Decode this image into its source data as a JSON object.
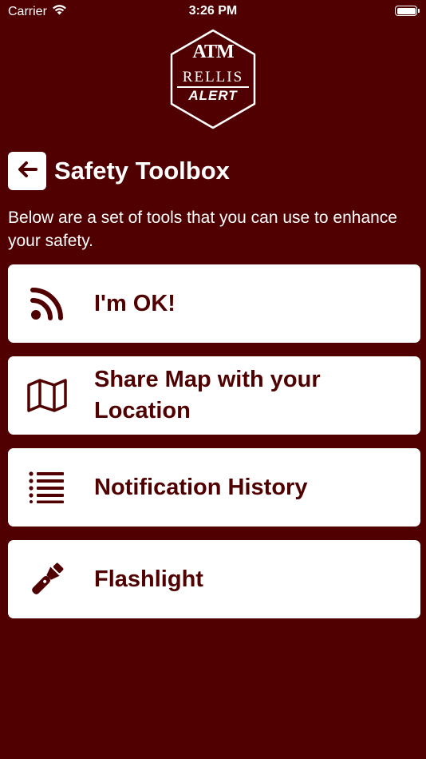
{
  "status_bar": {
    "carrier": "Carrier",
    "time": "3:26 PM",
    "icons": [
      "wifi-icon",
      "battery-icon"
    ]
  },
  "logo": {
    "monogram": "ATM",
    "name": "RELLIS",
    "tagline": "ALERT"
  },
  "header": {
    "back_icon": "arrow-left-icon",
    "title": "Safety Toolbox"
  },
  "intro_text": "Below are a set of tools that you can use to enhance your safety.",
  "tools": [
    {
      "label": "I'm OK!",
      "icon": "rss-icon"
    },
    {
      "label": "Share Map with your Location",
      "icon": "map-icon"
    },
    {
      "label": "Notification History",
      "icon": "list-icon"
    },
    {
      "label": "Flashlight",
      "icon": "flashlight-icon"
    }
  ],
  "colors": {
    "background": "#500000",
    "card": "#ffffff",
    "text_on_card": "#500000"
  }
}
